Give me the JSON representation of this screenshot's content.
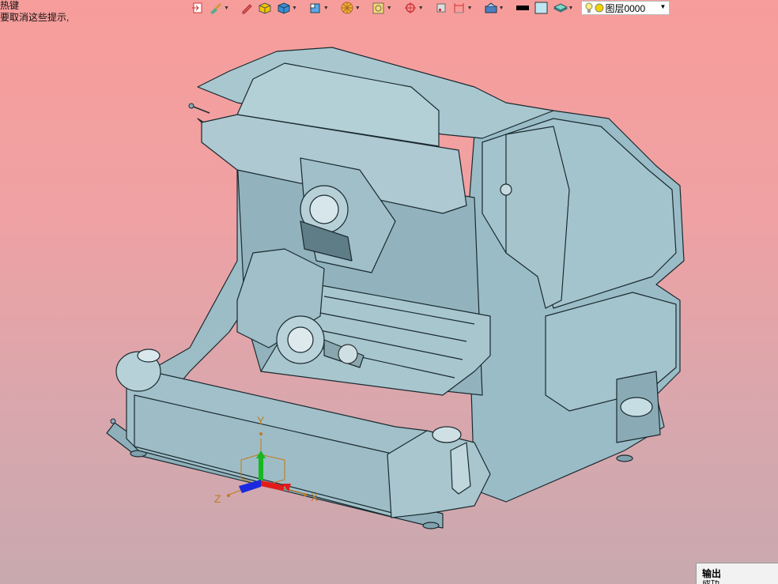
{
  "hint": {
    "line1": "热键",
    "line2": "要取消这些提示,"
  },
  "toolbar": {
    "icons": [
      "view-restore-icon",
      "brush-icon",
      "pen-icon",
      "box-shaded-icon",
      "cube-icon",
      "cube-view-icon",
      "wheel-icon",
      "box-frame-icon",
      "crosshair-icon",
      "square-icon",
      "dimension-icon",
      "layer-manager-icon",
      "color-swatch-icon",
      "fill-icon",
      "stack-icon"
    ],
    "layer_name": "图层0000",
    "color_black": "#000000",
    "color_fill": "#bfe6f0"
  },
  "axes": {
    "x": "X",
    "y": "Y",
    "z": "Z"
  },
  "output_panel": {
    "title": "输出",
    "line": "成功..."
  },
  "model": {
    "body_color": "#98b9c3",
    "edge_color": "#1a2a30"
  }
}
